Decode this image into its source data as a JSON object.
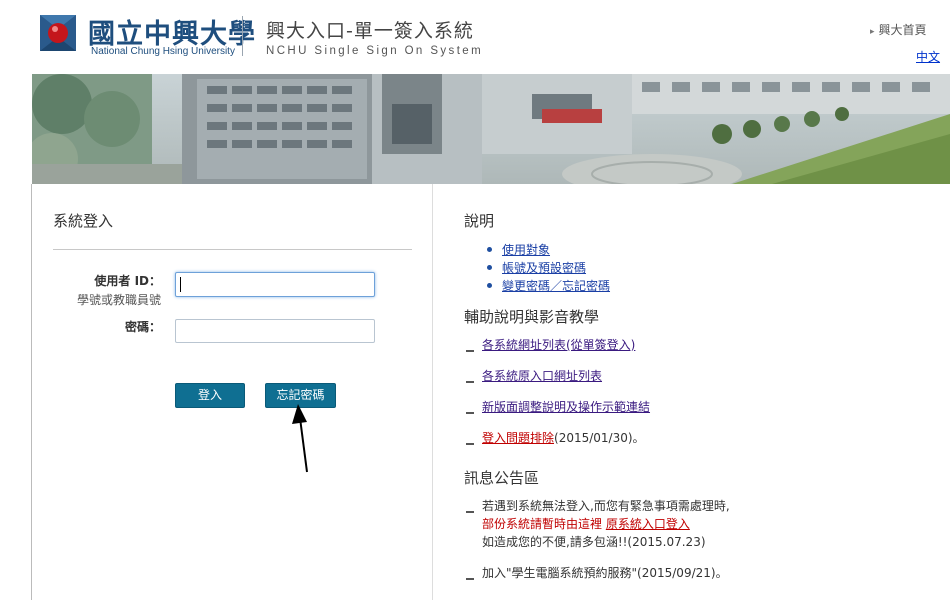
{
  "header": {
    "university_name_cn": "國立中興大學",
    "university_name_en": "National Chung Hsing University",
    "system_title_cn": "興大入口-單一簽入系統",
    "system_title_en": "NCHU Single Sign On System",
    "home_link": "興大首頁",
    "language_link": "中文"
  },
  "login": {
    "title": "系統登入",
    "username_label": "使用者 ID：",
    "username_hint": "學號或教職員號",
    "username_value": "",
    "password_label": "密碼：",
    "password_value": "",
    "login_button": "登入",
    "forgot_button": "忘記密碼"
  },
  "info": {
    "heading": "說明",
    "items": [
      "使用對象",
      "帳號及預設密碼",
      "變更密碼／忘記密碼"
    ]
  },
  "help": {
    "heading": "輔助說明與影音教學",
    "items": [
      {
        "link": "各系統網址列表(從單簽登入)"
      },
      {
        "link": "各系統原入口網址列表"
      },
      {
        "link": "新版面調整說明及操作示範連結"
      },
      {
        "link": "登入問題排除",
        "suffix": "(2015/01/30)。"
      }
    ]
  },
  "news": {
    "heading": "訊息公告區",
    "item1_line1": "若遇到系統無法登入,而您有緊急事項需處理時,",
    "item1_line2_red": "部份系統請暫時由這裡 ",
    "item1_line2_link": "原系統入口登入",
    "item1_line3": "如造成您的不便,請多包涵!!(2015.07.23)",
    "item2": "加入\"學生電腦系統預約服務\"(2015/09/21)。"
  },
  "colors": {
    "brand_blue": "#1e4e7e",
    "button_teal": "#0f6f92",
    "link_blue": "#1a3fa5",
    "alert_red": "#c00000"
  }
}
